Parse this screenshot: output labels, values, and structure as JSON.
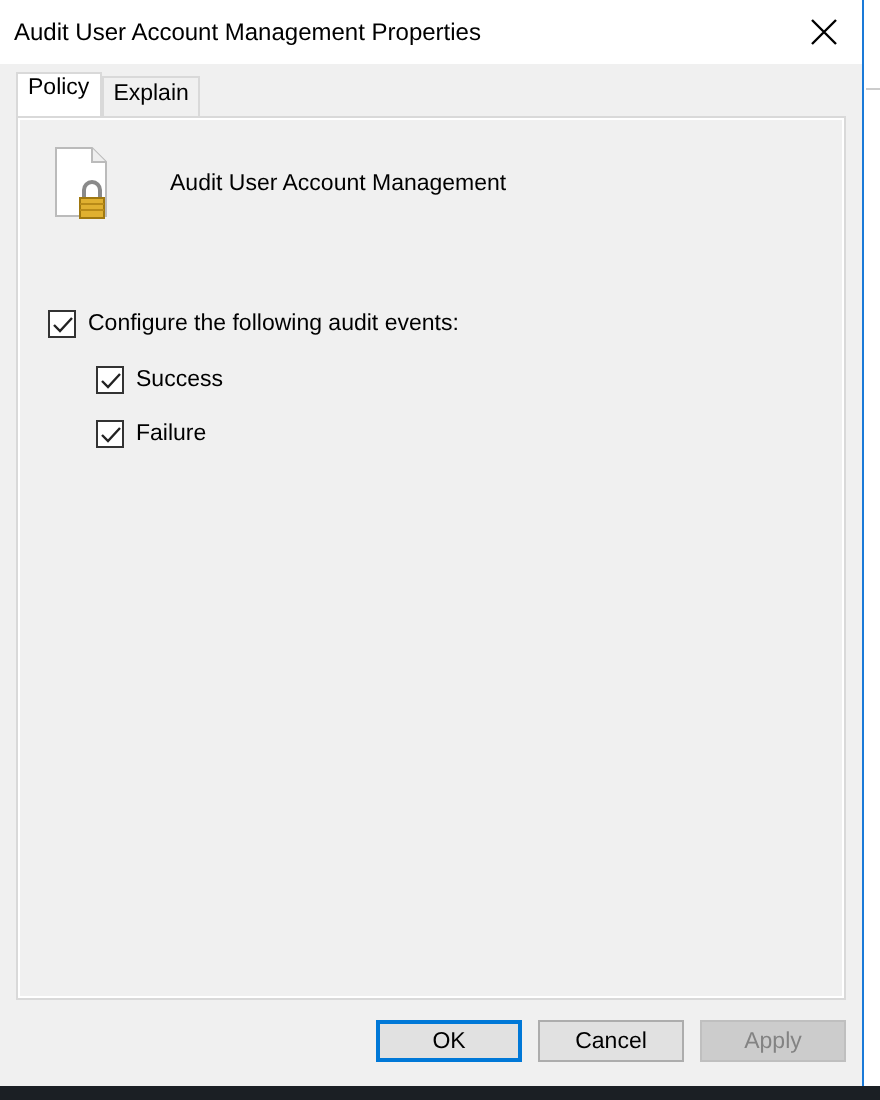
{
  "window": {
    "title": "Audit User Account Management Properties"
  },
  "tabs": [
    {
      "label": "Policy",
      "selected": true
    },
    {
      "label": "Explain",
      "selected": false
    }
  ],
  "policy": {
    "name": "Audit User Account Management"
  },
  "options": [
    {
      "label": "Configure the following audit events:",
      "checked": true,
      "children": [
        {
          "label": "Success",
          "checked": true
        },
        {
          "label": "Failure",
          "checked": true
        }
      ]
    }
  ],
  "buttons": [
    {
      "label": "OK",
      "default": true,
      "disabled": false
    },
    {
      "label": "Cancel",
      "default": false,
      "disabled": false
    },
    {
      "label": "Apply",
      "default": false,
      "disabled": true
    }
  ]
}
